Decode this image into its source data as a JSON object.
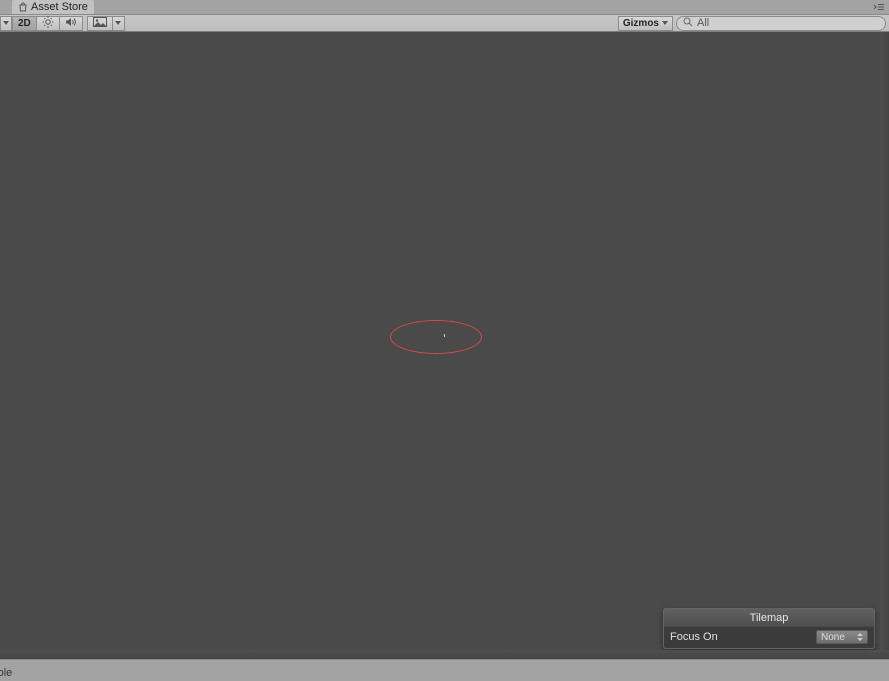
{
  "tab": {
    "title": "Asset Store"
  },
  "toolbar": {
    "mode2d": "2D",
    "gizmos": "Gizmos",
    "search_value": "All"
  },
  "tilemap": {
    "title": "Tilemap",
    "focus_label": "Focus On",
    "focus_value": "None"
  },
  "console": {
    "label": "nsole"
  }
}
